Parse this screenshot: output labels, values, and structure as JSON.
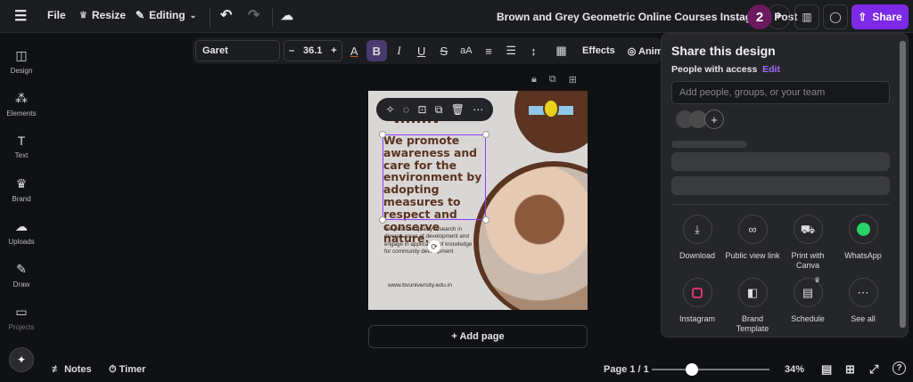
{
  "topbar": {
    "file": "File",
    "resize": "Resize",
    "editing": "Editing",
    "title": "Brown and Grey Geometric Online Courses Instagram Post",
    "collab_count": "2",
    "share": "Share"
  },
  "sidebar": {
    "items": [
      {
        "label": "Design"
      },
      {
        "label": "Elements"
      },
      {
        "label": "Text"
      },
      {
        "label": "Brand"
      },
      {
        "label": "Uploads"
      },
      {
        "label": "Draw"
      },
      {
        "label": "Projects"
      }
    ]
  },
  "toolbar": {
    "font": "Garet",
    "font_size": "36.1",
    "minus": "–",
    "plus": "+",
    "case": "aA",
    "effects": "Effects",
    "animate": "Anim"
  },
  "design": {
    "heading": "We promote awareness and care for the environment by adopting measures to respect and conserve nature.",
    "body": "We promote quality research in diverse areas of development and engage in application of knowledge for community development",
    "website": "www.bvuniversity.edu.in"
  },
  "add_page": "+ Add page",
  "share_panel": {
    "title": "Share this design",
    "access_label": "People with access",
    "edit": "Edit",
    "input_placeholder": "Add people, groups, or your team",
    "options": [
      {
        "label": "Download",
        "icon": "download-icon"
      },
      {
        "label": "Public view link",
        "icon": "link-icon"
      },
      {
        "label": "Print with Canva",
        "icon": "truck-icon"
      },
      {
        "label": "WhatsApp",
        "icon": "whatsapp-icon"
      },
      {
        "label": "Instagram",
        "icon": "instagram-icon"
      },
      {
        "label": "Brand Template",
        "icon": "template-icon"
      },
      {
        "label": "Schedule",
        "icon": "calendar-icon"
      },
      {
        "label": "See all",
        "icon": "more-icon"
      }
    ]
  },
  "bottom": {
    "notes": "Notes",
    "timer": "Timer",
    "page": "Page 1 / 1",
    "zoom": "34%",
    "zoom_value": 0.34
  },
  "colors": {
    "accent": "#7d2ae8",
    "brown": "#5b3422",
    "avatar": "#6b1a5e"
  }
}
